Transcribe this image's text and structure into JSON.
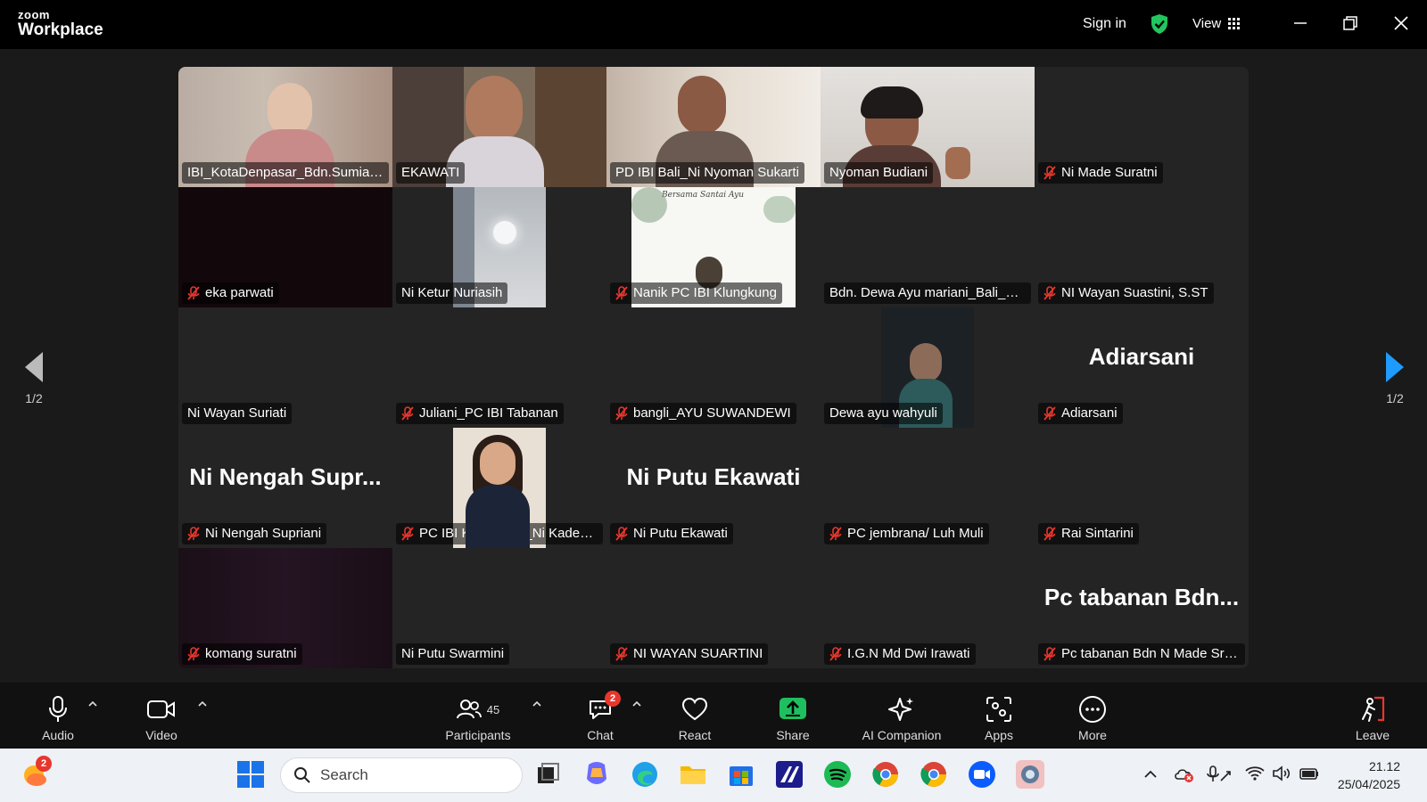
{
  "app": {
    "logo_top": "zoom",
    "logo_bottom": "Workplace",
    "sign_in": "Sign in",
    "view": "View"
  },
  "pager": {
    "left": "1/2",
    "right": "1/2"
  },
  "tiles": [
    {
      "name": "IBI_KotaDenpasar_Bdn.Sumiati,...",
      "muted": false,
      "video": "v1"
    },
    {
      "name": "EKAWATI",
      "muted": false,
      "video": "v2"
    },
    {
      "name": "PD IBI Bali_Ni Nyoman Sukarti",
      "muted": false,
      "video": "v3"
    },
    {
      "name": "Nyoman Budiani",
      "muted": false,
      "video": "v4",
      "speaking": true
    },
    {
      "name": "Ni Made Suratni",
      "muted": true
    },
    {
      "name": "eka parwati",
      "muted": true,
      "video": "dark"
    },
    {
      "name": "Ni Ketur Nuriasih",
      "muted": false,
      "video": "room"
    },
    {
      "name": "Nanik PC IBI Klungkung",
      "muted": true,
      "video": "slide"
    },
    {
      "name": "Bdn. Dewa Ayu mariani_Bali_Gi...",
      "muted": false
    },
    {
      "name": "NI Wayan Suastini, S.ST",
      "muted": true
    },
    {
      "name": "Ni Wayan Suriati",
      "muted": false
    },
    {
      "name": "Juliani_PC IBI Tabanan",
      "muted": true
    },
    {
      "name": "bangli_AYU SUWANDEWI",
      "muted": true
    },
    {
      "name": "Dewa ayu wahyuli",
      "muted": false,
      "video": "car"
    },
    {
      "name": "Adiarsani",
      "muted": true,
      "big": "Adiarsani"
    },
    {
      "name": "Ni Nengah Supriani",
      "muted": true,
      "big": "Ni Nengah Supr..."
    },
    {
      "name": "PC IBI Klungkung_Ni Kadek ...",
      "muted": true,
      "video": "portrait"
    },
    {
      "name": "Ni Putu Ekawati",
      "muted": true,
      "big": "Ni Putu Ekawati"
    },
    {
      "name": "PC jembrana/ Luh Muli",
      "muted": true
    },
    {
      "name": "Rai Sintarini",
      "muted": true
    },
    {
      "name": "komang suratni",
      "muted": true,
      "video": "darkpurple"
    },
    {
      "name": "Ni Putu Swarmini",
      "muted": false
    },
    {
      "name": "NI WAYAN SUARTINI",
      "muted": true
    },
    {
      "name": "I.G.N Md Dwi Irawati",
      "muted": true
    },
    {
      "name": "Pc tabanan Bdn N Made Sri ...",
      "muted": true,
      "big": "Pc tabanan Bdn..."
    }
  ],
  "toolbar": {
    "audio": "Audio",
    "video": "Video",
    "participants": "Participants",
    "participants_count": "45",
    "chat": "Chat",
    "chat_badge": "2",
    "react": "React",
    "share": "Share",
    "ai_companion": "AI Companion",
    "apps": "Apps",
    "more": "More",
    "leave": "Leave"
  },
  "taskbar": {
    "search_placeholder": "Search",
    "weather_badge": "2",
    "time": "21.12",
    "date": "25/04/2025"
  },
  "colors": {
    "speaking_outline": "#2fd17c",
    "share_green": "#1fbf5f",
    "mute_red": "#e8362d",
    "pager_blue": "#1e9bff"
  }
}
